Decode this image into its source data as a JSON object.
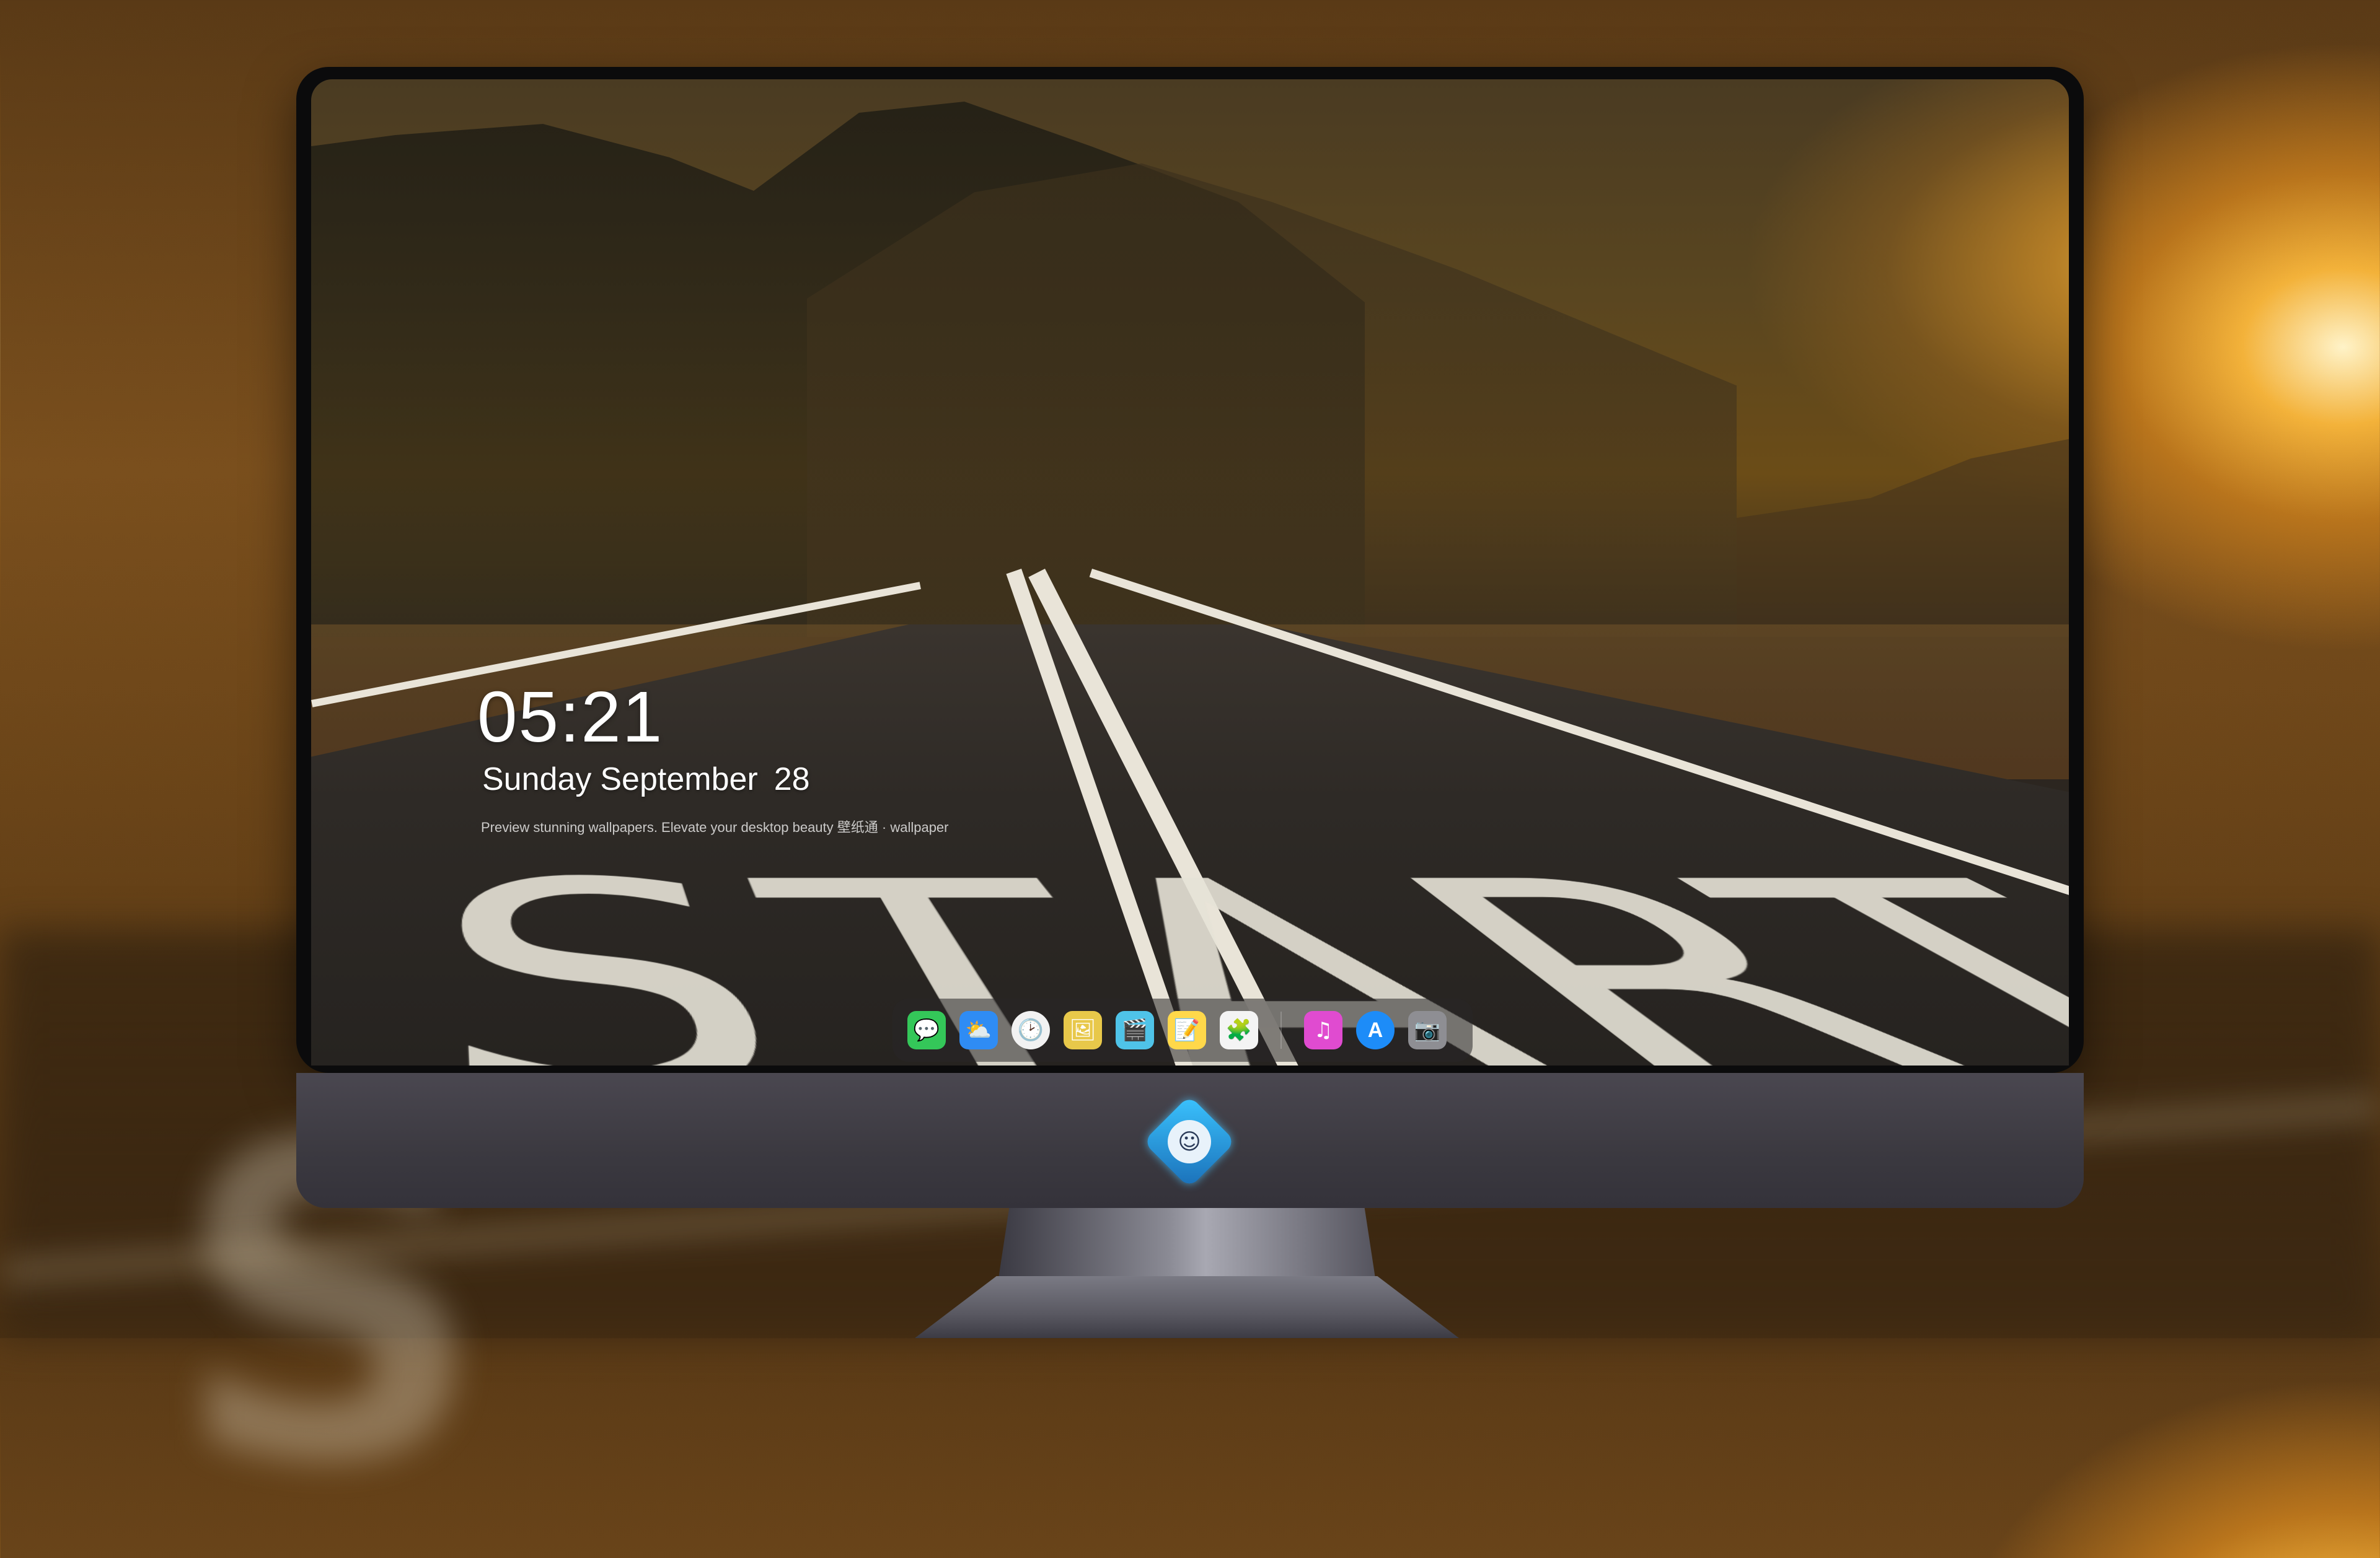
{
  "lockscreen": {
    "time": "05:21",
    "weekday": "Sunday",
    "month": "September",
    "day": "28",
    "caption": "Preview stunning wallpapers. Elevate your desktop beauty  壁纸通 · wallpaper"
  },
  "wallpaper": {
    "road_text": "START"
  },
  "dock": {
    "apps": [
      {
        "name": "Messages",
        "icon": "chat-bubble-icon",
        "glyph": "💬",
        "color": "#34c759"
      },
      {
        "name": "Weather",
        "icon": "weather-icon",
        "glyph": "⛅",
        "color": "#2f8cf4"
      },
      {
        "name": "Clock",
        "icon": "clock-icon",
        "glyph": "🕑",
        "color": "#f2f2f2"
      },
      {
        "name": "Preview",
        "icon": "preview-icon",
        "glyph": "🖼",
        "color": "#e8c84a"
      },
      {
        "name": "Clips",
        "icon": "clapperboard-icon",
        "glyph": "🎬",
        "color": "#4fc3e8"
      },
      {
        "name": "Notes",
        "icon": "notes-icon",
        "glyph": "📝",
        "color": "#ffd84a"
      },
      {
        "name": "Photos",
        "icon": "photos-icon",
        "glyph": "🧩",
        "color": "#f4f4f4"
      },
      {
        "name": "Music",
        "icon": "music-note-icon",
        "glyph": "♫",
        "color": "#e04bd0"
      },
      {
        "name": "App Store",
        "icon": "app-store-icon",
        "glyph": "A",
        "color": "#1d8cf8"
      },
      {
        "name": "Camera",
        "icon": "camera-icon",
        "glyph": "📷",
        "color": "#8e8e93"
      }
    ]
  },
  "monitor": {
    "logo_icon": "mascot-logo-icon",
    "bezel_color": "#0b0b0c",
    "chin_color": "#3b3940"
  }
}
